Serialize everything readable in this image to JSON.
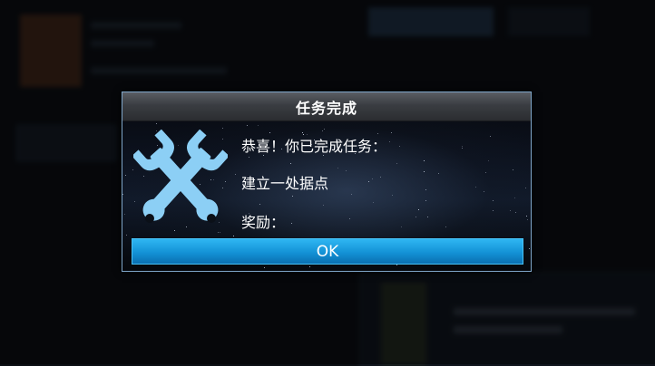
{
  "dialog": {
    "title": "任务完成",
    "line1": "恭喜！你已完成任务：",
    "line2": "建立一处据点",
    "line3": "奖励：",
    "ok_label": "OK",
    "icon": "wrench-cross-icon"
  },
  "colors": {
    "icon": "#8ccff5",
    "ok_button": "#1392d6",
    "border": "#7fa6c9"
  }
}
